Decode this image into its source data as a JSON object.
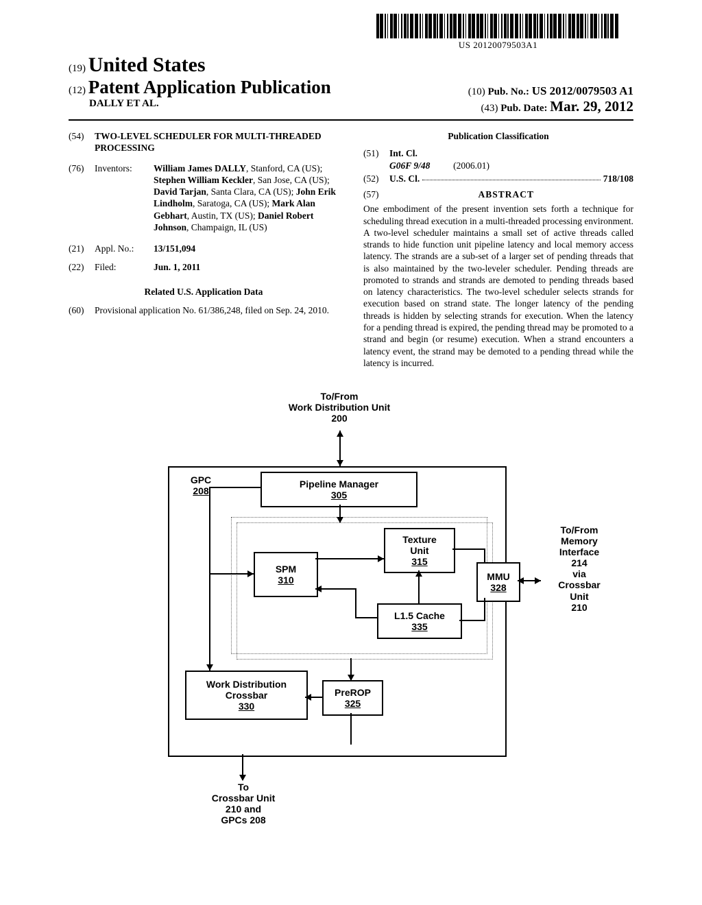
{
  "barcode_text": "US 20120079503A1",
  "header": {
    "country_num": "(19)",
    "country": "United States",
    "kind_num": "(12)",
    "kind": "Patent Application Publication",
    "pubno_num": "(10)",
    "pubno_label": "Pub. No.:",
    "pubno": "US 2012/0079503 A1",
    "author": "DALLY et al.",
    "pubdate_num": "(43)",
    "pubdate_label": "Pub. Date:",
    "pubdate": "Mar. 29, 2012"
  },
  "fields": {
    "title_num": "(54)",
    "title": "TWO-LEVEL SCHEDULER FOR MULTI-THREADED PROCESSING",
    "inventors_num": "(76)",
    "inventors_label": "Inventors:",
    "inventors_html": "William James DALLY|, Stanford, CA (US); |Stephen William Keckler|, San Jose, CA (US); |David Tarjan|, Santa Clara, CA (US); |John Erik Lindholm|, Saratoga, CA (US); |Mark Alan Gebhart|, Austin, TX (US); |Daniel Robert Johnson|, Champaign, IL (US)",
    "appl_num_num": "(21)",
    "appl_num_label": "Appl. No.:",
    "appl_num": "13/151,094",
    "filed_num": "(22)",
    "filed_label": "Filed:",
    "filed": "Jun. 1, 2011",
    "related_head": "Related U.S. Application Data",
    "prov_num": "(60)",
    "prov_text": "Provisional application No. 61/386,248, filed on Sep. 24, 2010."
  },
  "classification": {
    "head": "Publication Classification",
    "intcl_num": "(51)",
    "intcl_label": "Int. Cl.",
    "intcl_code": "G06F 9/48",
    "intcl_date": "(2006.01)",
    "uscl_num": "(52)",
    "uscl_label": "U.S. Cl.",
    "uscl_val": "718/108"
  },
  "abstract": {
    "num": "(57)",
    "head": "ABSTRACT",
    "text": "One embodiment of the present invention sets forth a technique for scheduling thread execution in a multi-threaded processing environment. A two-level scheduler maintains a small set of active threads called strands to hide function unit pipeline latency and local memory access latency. The strands are a sub-set of a larger set of pending threads that is also maintained by the two-leveler scheduler. Pending threads are promoted to strands and strands are demoted to pending threads based on latency characteristics. The two-level scheduler selects strands for execution based on strand state. The longer latency of the pending threads is hidden by selecting strands for execution. When the latency for a pending thread is expired, the pending thread may be promoted to a strand and begin (or resume) execution. When a strand encounters a latency event, the strand may be demoted to a pending thread while the latency is incurred."
  },
  "figure": {
    "top_label": "To/From\nWork Distribution Unit\n200",
    "gpc": "GPC",
    "gpc_ref": "208",
    "pipeline": "Pipeline Manager",
    "pipeline_ref": "305",
    "spm": "SPM",
    "spm_ref": "310",
    "texture": "Texture\nUnit",
    "texture_ref": "315",
    "l15": "L1.5 Cache",
    "l15_ref": "335",
    "mmu": "MMU",
    "mmu_ref": "328",
    "wdc": "Work Distribution\nCrossbar",
    "wdc_ref": "330",
    "prerop": "PreROP",
    "prerop_ref": "325",
    "right_label": "To/From\nMemory\nInterface\n214\nvia\nCrossbar\nUnit\n210",
    "bottom_label": "To\nCrossbar Unit\n210 and\nGPCs 208"
  }
}
